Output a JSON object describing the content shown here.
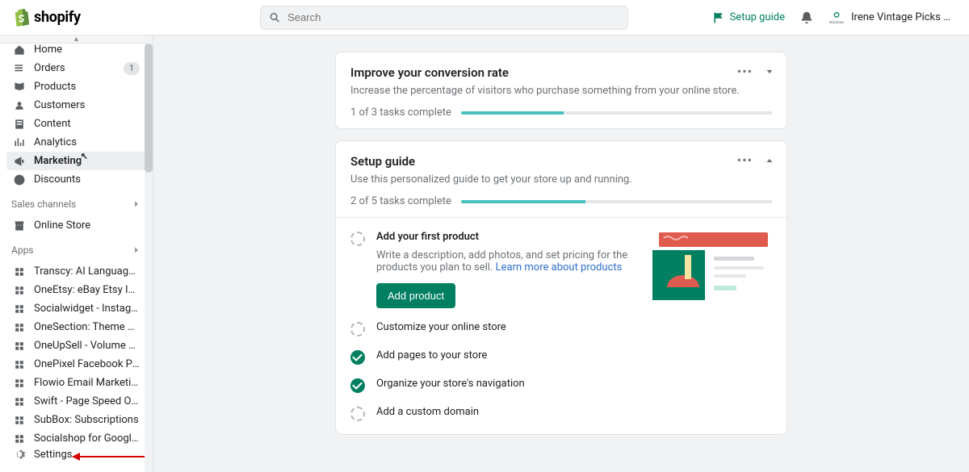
{
  "brand": {
    "name": "shopify"
  },
  "search": {
    "placeholder": "Search"
  },
  "header": {
    "setup_link": "Setup guide",
    "store_name": "Irene Vintage Picks Ad..."
  },
  "sidebar": {
    "main": [
      {
        "icon": "home-icon",
        "label": "Home",
        "clipped": true
      },
      {
        "icon": "orders-icon",
        "label": "Orders",
        "badge": "1"
      },
      {
        "icon": "products-icon",
        "label": "Products"
      },
      {
        "icon": "customers-icon",
        "label": "Customers"
      },
      {
        "icon": "content-icon",
        "label": "Content"
      },
      {
        "icon": "analytics-icon",
        "label": "Analytics"
      },
      {
        "icon": "marketing-icon",
        "label": "Marketing",
        "active": true,
        "cursor": true
      },
      {
        "icon": "discounts-icon",
        "label": "Discounts"
      }
    ],
    "sales_head": "Sales channels",
    "sales": [
      {
        "icon": "store-icon",
        "label": "Online Store"
      }
    ],
    "apps_head": "Apps",
    "apps": [
      {
        "label": "Transcy: AI Language Tr..."
      },
      {
        "label": "OneEtsy: eBay Etsy Inte..."
      },
      {
        "label": "Socialwidget - Instagra..."
      },
      {
        "label": "OneSection: Theme sect..."
      },
      {
        "label": "OneUpSell - Volume Dis..."
      },
      {
        "label": "OnePixel Facebook Pixel..."
      },
      {
        "label": "Flowio Email Marketing,..."
      },
      {
        "label": "Swift - Page Speed Opti..."
      },
      {
        "label": "SubBox: Subscriptions"
      },
      {
        "label": "Socialshop for Google S..."
      }
    ],
    "settings": "Settings"
  },
  "cards": {
    "conversion": {
      "title": "Improve your conversion rate",
      "sub": "Increase the percentage of visitors who purchase something from your online store.",
      "progress_text": "1 of 3 tasks complete",
      "progress_pct": 33
    },
    "setup": {
      "title": "Setup guide",
      "sub": "Use this personalized guide to get your store up and running.",
      "progress_text": "2 of 5 tasks complete",
      "progress_pct": 40,
      "tasks": [
        {
          "title": "Add your first product",
          "expanded": true,
          "desc": "Write a description, add photos, and set pricing for the products you plan to sell. ",
          "link": "Learn more about products",
          "button": "Add product",
          "done": false
        },
        {
          "title": "Customize your online store",
          "done": false
        },
        {
          "title": "Add pages to your store",
          "done": true
        },
        {
          "title": "Organize your store's navigation",
          "done": true
        },
        {
          "title": "Add a custom domain",
          "done": false
        }
      ]
    }
  }
}
